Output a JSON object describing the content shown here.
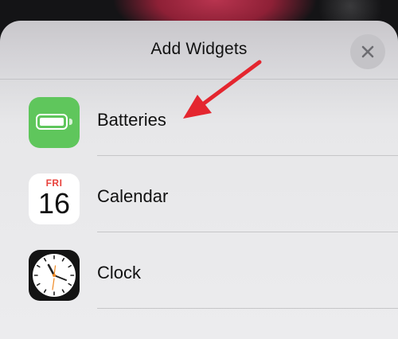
{
  "sheet": {
    "title": "Add Widgets",
    "close_icon": "close-icon"
  },
  "widgets": [
    {
      "label": "Batteries",
      "icon": "battery-icon",
      "icon_color": "#5fc65c"
    },
    {
      "label": "Calendar",
      "icon": "calendar-icon",
      "day": "FRI",
      "date": "16",
      "day_color": "#e8413b"
    },
    {
      "label": "Clock",
      "icon": "clock-icon"
    }
  ],
  "annotation": {
    "icon": "red-arrow-icon",
    "color": "#e4262f"
  }
}
